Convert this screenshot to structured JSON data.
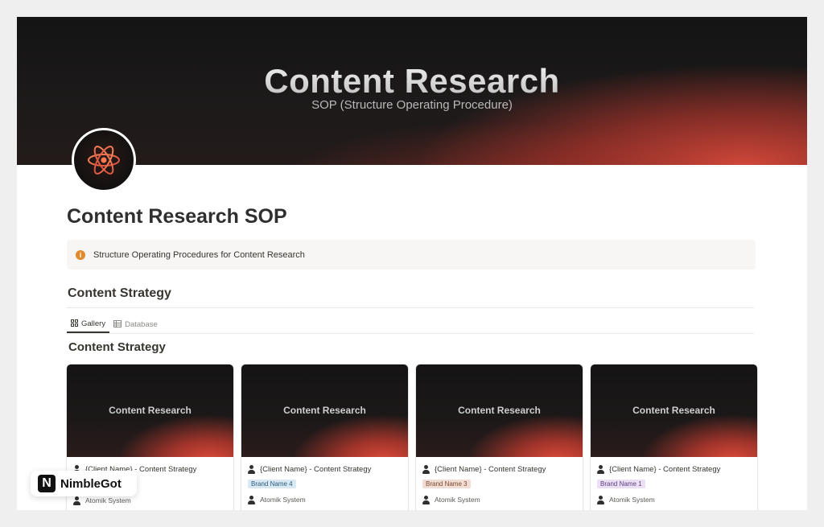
{
  "cover": {
    "title": "Content Research",
    "subtitle": "SOP (Structure Operating Procedure)"
  },
  "page": {
    "icon": "atom-icon",
    "title": "Content Research SOP"
  },
  "callout": {
    "icon": "info-icon",
    "text": "Structure Operating Procedures for Content Research"
  },
  "section": {
    "heading": "Content Strategy"
  },
  "view_tabs": [
    {
      "label": "Gallery",
      "icon": "gallery-icon",
      "active": true
    },
    {
      "label": "Database",
      "icon": "table-icon",
      "active": false
    }
  ],
  "gallery": {
    "heading": "Content Strategy",
    "cards": [
      {
        "thumb_text": "Content Research",
        "title": "{Client Name} - Content Strategy",
        "tag": "",
        "tag_color": "",
        "tag_bg": "",
        "author": "Atomik System"
      },
      {
        "thumb_text": "Content Research",
        "title": "{Client Name} - Content Strategy",
        "tag": "Brand Name 4",
        "tag_color": "#2b5b7a",
        "tag_bg": "#d8e9f3",
        "author": "Atomik System"
      },
      {
        "thumb_text": "Content Research",
        "title": "{Client Name} - Content Strategy",
        "tag": "Brand Name 3",
        "tag_color": "#7a4a32",
        "tag_bg": "#f1ddd3",
        "author": "Atomik System"
      },
      {
        "thumb_text": "Content Research",
        "title": "{Client Name} - Content Strategy",
        "tag": "Brand Name 1",
        "tag_color": "#5e3f7d",
        "tag_bg": "#ebdff5",
        "author": "Atomik System"
      }
    ]
  },
  "watermark": {
    "mark": "N",
    "text": "NimbleGot"
  },
  "colors": {
    "accent": "#d8483a",
    "info": "#e08a2b"
  }
}
